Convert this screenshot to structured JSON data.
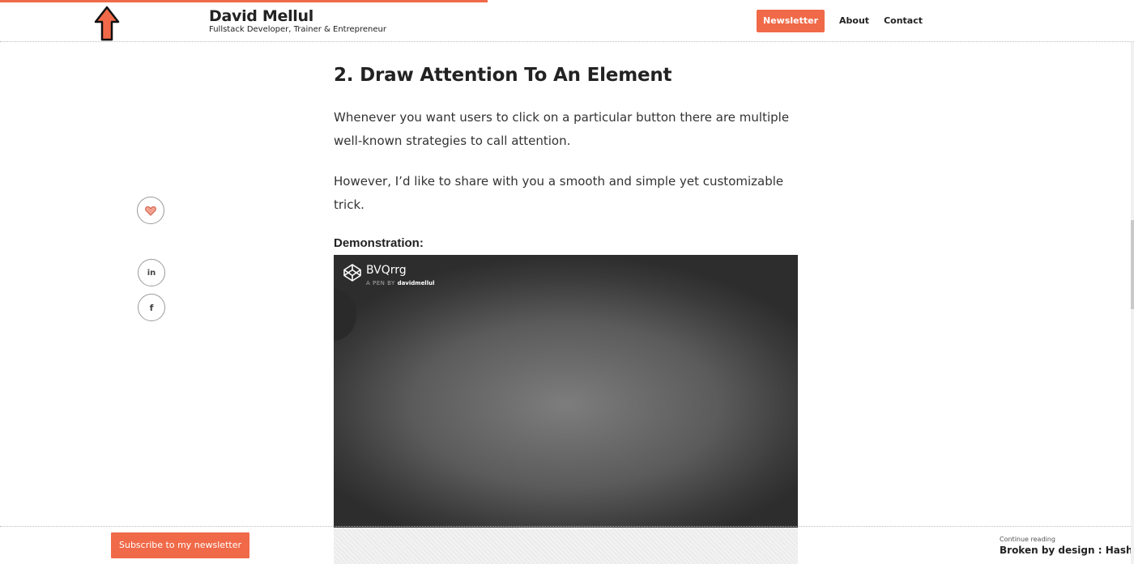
{
  "progress": {
    "percent": 43
  },
  "header": {
    "brand_name": "David Mellul",
    "tagline": "Fullstack Developer, Trainer & Entrepreneur",
    "nav": {
      "newsletter": "Newsletter",
      "about": "About",
      "contact": "Contact"
    }
  },
  "article": {
    "heading": "2. Draw Attention To An Element",
    "paragraph1": "Whenever you want users to click on a particular button there are multiple well-known strategies to call attention.",
    "paragraph2": "However, I’d like to share with you a smooth and simple yet customizable trick.",
    "demo_label": "Demonstration:"
  },
  "pen": {
    "title": "BVQrrg",
    "by_label": "A PEN BY",
    "author": "davidmellul"
  },
  "share": {
    "linkedin": "in",
    "facebook": "f"
  },
  "bottom": {
    "subscribe": "Subscribe to my newsletter",
    "continue_label": "Continue reading",
    "continue_title": "Broken by design : Hash"
  },
  "colors": {
    "accent": "#f06a49"
  },
  "icons": {
    "scroll_top": "up-arrow-icon",
    "clap": "heart-icon",
    "codepen": "codepen-logo-icon"
  }
}
